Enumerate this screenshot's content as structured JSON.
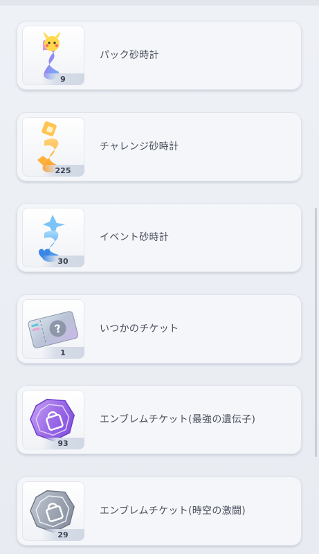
{
  "items": [
    {
      "name": "パック砂時計",
      "count": "9"
    },
    {
      "name": "チャレンジ砂時計",
      "count": "225"
    },
    {
      "name": "イベント砂時計",
      "count": "30"
    },
    {
      "name": "いつかのチケット",
      "count": "1"
    },
    {
      "name": "エンブレムチケット(最強の遺伝子)",
      "count": "93"
    },
    {
      "name": "エンブレムチケット(時空の激闘)",
      "count": "29"
    }
  ],
  "icons": [
    "pack-hourglass-icon",
    "challenge-hourglass-icon",
    "event-hourglass-icon",
    "someday-ticket-icon",
    "emblem-ticket-purple-icon",
    "emblem-ticket-gray-icon"
  ],
  "colors": {
    "background": "#eaeef4",
    "card": "#f4f6f9",
    "text": "#4a4f5c"
  }
}
